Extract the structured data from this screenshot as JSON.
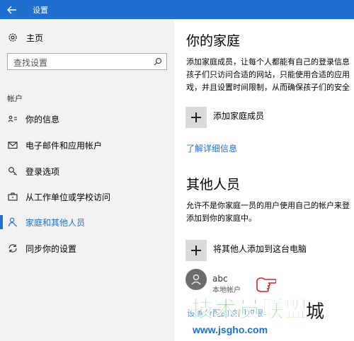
{
  "titlebar": {
    "title": "设置",
    "back_icon": "arrow-left-icon"
  },
  "sidebar": {
    "home_label": "主页",
    "search_placeholder": "查找设置",
    "section_title": "帐户",
    "items": [
      {
        "label": "你的信息",
        "icon": "contact-card-icon",
        "active": false
      },
      {
        "label": "电子邮件和应用帐户",
        "icon": "mail-icon",
        "active": false
      },
      {
        "label": "登录选项",
        "icon": "key-icon",
        "active": false
      },
      {
        "label": "从工作单位或学校访问",
        "icon": "briefcase-icon",
        "active": false
      },
      {
        "label": "家庭和其他人员",
        "icon": "person-icon",
        "active": true
      },
      {
        "label": "同步你的设置",
        "icon": "sync-icon",
        "active": false
      }
    ]
  },
  "main": {
    "family_heading": "你的家庭",
    "family_desc_lines": [
      "添加家庭成员，让每个人都能有自己的登录信息",
      "孩子们只访问合适的网站，只能使用合适的应用",
      "戏，并且设置时间限制，从而确保孩子们的安全"
    ],
    "add_family_label": "添加家庭成员",
    "learn_more": "了解详细信息",
    "others_heading": "其他人员",
    "others_desc_lines": [
      "允许不是你家庭一员的用户使用自己的帐户来登",
      "添加到你的家庭中。"
    ],
    "add_other_label": "将其他人添加到这台电脑",
    "user": {
      "name": "abc",
      "type": "本地帐户"
    },
    "partial_link": "设置分配的访问权限"
  },
  "watermark": {
    "text": "技术员联盟",
    "city": "城",
    "url": "www.jsgho.com"
  },
  "colors": {
    "accent": "#1f6fd0",
    "sidebar_bg": "#f2f2f2",
    "watermark_green": "#18a92a"
  }
}
